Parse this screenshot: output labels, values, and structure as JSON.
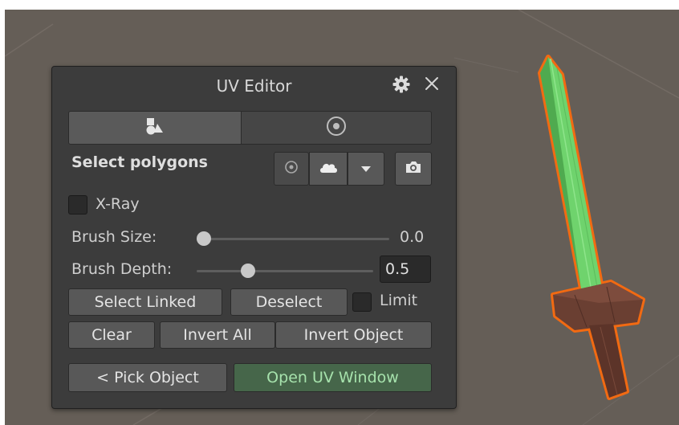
{
  "panel": {
    "title": "UV Editor",
    "mode_label": "Select polygons",
    "xray_label": "X-Ray",
    "xray_checked": false,
    "brush_size": {
      "label": "Brush Size:",
      "value": "0.0",
      "fraction": 0.0
    },
    "brush_depth": {
      "label": "Brush Depth:",
      "value": "0.5",
      "fraction": 0.27
    },
    "select_linked_label": "Select Linked",
    "deselect_label": "Deselect",
    "limit_label": "Limit",
    "limit_checked": false,
    "clear_label": "Clear",
    "invert_all_label": "Invert All",
    "invert_object_label": "Invert Object",
    "pick_object_label": "< Pick Object",
    "open_uv_window_label": "Open UV Window",
    "active_tab": 0
  },
  "icons": [
    "gear-icon",
    "close-icon",
    "shapes-icon",
    "target-icon",
    "cloud-icon",
    "dropdown-arrow-icon",
    "camera-icon"
  ],
  "colors": {
    "viewport_bg": "#655e57",
    "panel_bg": "#3c3c3c",
    "button_bg": "#585858",
    "open_uv_button_bg": "#46664a",
    "open_uv_button_text": "#a6e2ac",
    "blade": "#6fd36d",
    "outline": "#f26a12",
    "hilt": "#6a3f32"
  }
}
